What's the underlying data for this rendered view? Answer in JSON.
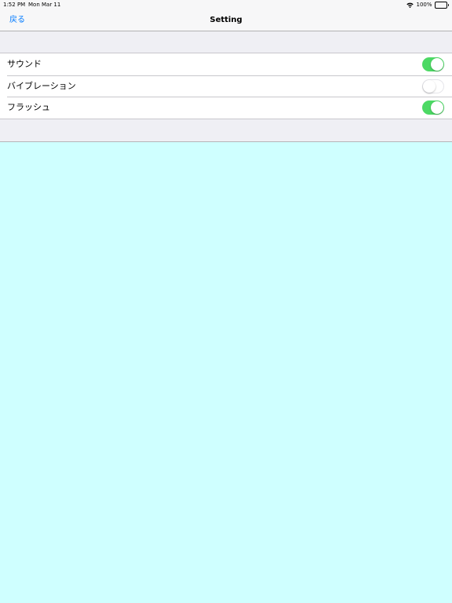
{
  "status_bar": {
    "time": "1:52 PM",
    "date": "Mon Mar 11",
    "battery": "100%"
  },
  "nav": {
    "back_label": "戻る",
    "title": "Setting"
  },
  "settings": {
    "sound": {
      "label": "サウンド",
      "enabled": true
    },
    "vibration": {
      "label": "バイブレーション",
      "enabled": false
    },
    "flash": {
      "label": "フラッシュ",
      "enabled": true
    }
  },
  "colors": {
    "accent": "#007aff",
    "toggle_on": "#4cd964",
    "content_background": "#cfffff",
    "group_background": "#efeff4"
  }
}
